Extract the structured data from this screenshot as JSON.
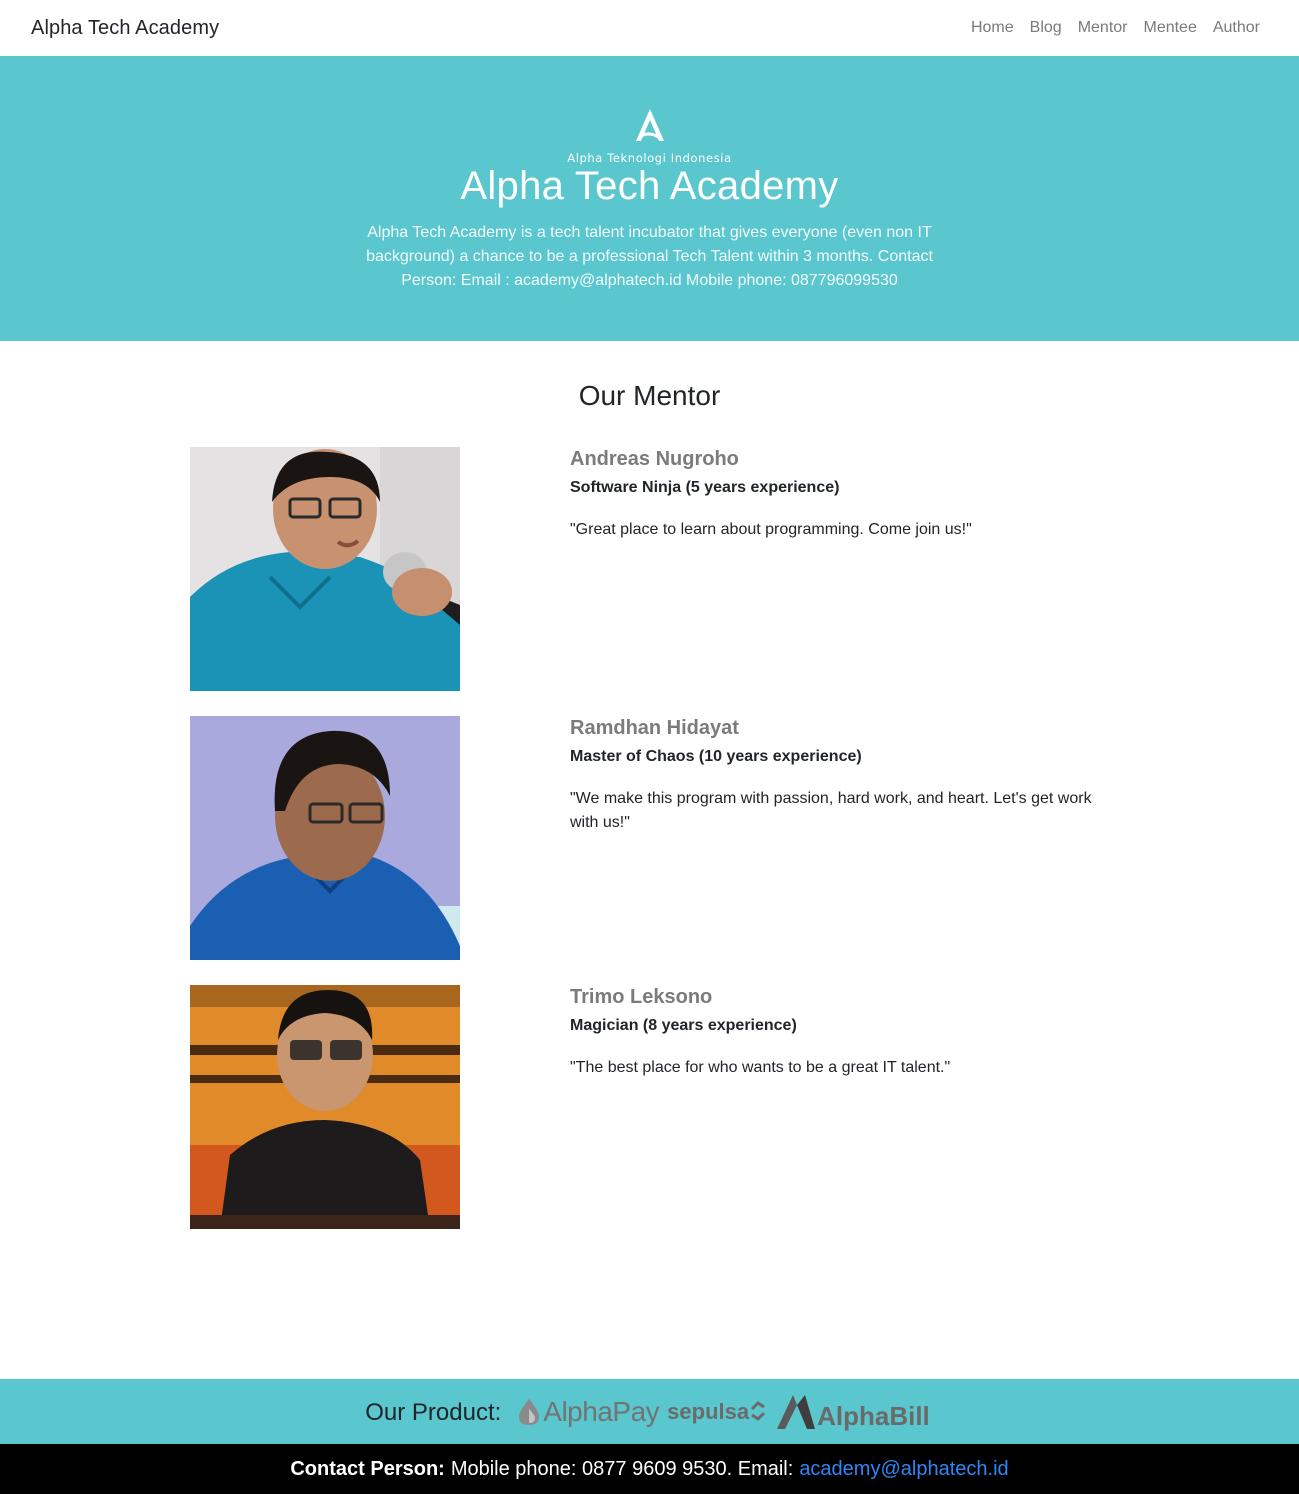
{
  "navbar": {
    "brand": "Alpha Tech Academy",
    "links": [
      "Home",
      "Blog",
      "Mentor",
      "Mentee",
      "Author"
    ]
  },
  "hero": {
    "logo_text": "Alpha Teknologi Indonesia",
    "title": "Alpha Tech Academy",
    "description": "Alpha Tech Academy is a tech talent incubator that gives everyone (even non IT background) a chance to be a professional Tech Talent within 3 months. Contact Person: Email : academy@alphatech.id Mobile phone: 087796099530"
  },
  "mentors_section": {
    "title": "Our Mentor",
    "mentors": [
      {
        "name": "Andreas Nugroho",
        "role": "Software Ninja (5 years experience)",
        "quote": "\"Great place to learn about programming. Come join us!\""
      },
      {
        "name": "Ramdhan Hidayat",
        "role": "Master of Chaos (10 years experience)",
        "quote": "\"We make this program with passion, hard work, and heart. Let's get work with us!\""
      },
      {
        "name": "Trimo Leksono",
        "role": "Magician (8 years experience)",
        "quote": "\"The best place for who wants to be a great IT talent.\""
      }
    ]
  },
  "products": {
    "label": "Our Product:",
    "items": [
      "AlphaPay",
      "sepulsa",
      "AlphaBill"
    ]
  },
  "footer": {
    "contact_label": "Contact Person:",
    "contact_text": "Mobile phone: 0877 9609 9530. Email:",
    "email": "academy@alphatech.id"
  },
  "colors": {
    "teal": "#5ac7cf",
    "footer_bg": "#000000",
    "link_blue": "#2f86f6",
    "mentor_name_gray": "#7b7b7b"
  }
}
